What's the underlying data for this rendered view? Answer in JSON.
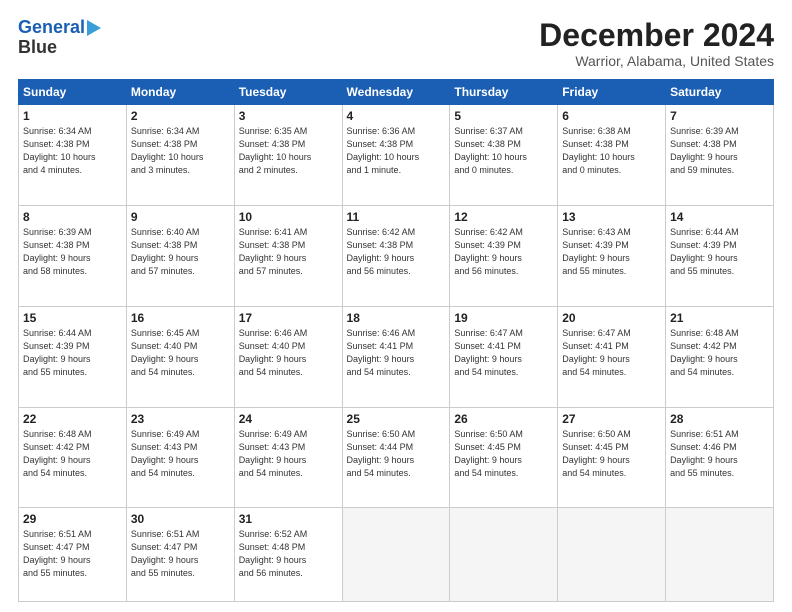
{
  "header": {
    "logo_line1": "General",
    "logo_line2": "Blue",
    "title": "December 2024",
    "subtitle": "Warrior, Alabama, United States"
  },
  "calendar": {
    "headers": [
      "Sunday",
      "Monday",
      "Tuesday",
      "Wednesday",
      "Thursday",
      "Friday",
      "Saturday"
    ],
    "rows": [
      [
        {
          "day": "1",
          "info": "Sunrise: 6:34 AM\nSunset: 4:38 PM\nDaylight: 10 hours\nand 4 minutes."
        },
        {
          "day": "2",
          "info": "Sunrise: 6:34 AM\nSunset: 4:38 PM\nDaylight: 10 hours\nand 3 minutes."
        },
        {
          "day": "3",
          "info": "Sunrise: 6:35 AM\nSunset: 4:38 PM\nDaylight: 10 hours\nand 2 minutes."
        },
        {
          "day": "4",
          "info": "Sunrise: 6:36 AM\nSunset: 4:38 PM\nDaylight: 10 hours\nand 1 minute."
        },
        {
          "day": "5",
          "info": "Sunrise: 6:37 AM\nSunset: 4:38 PM\nDaylight: 10 hours\nand 0 minutes."
        },
        {
          "day": "6",
          "info": "Sunrise: 6:38 AM\nSunset: 4:38 PM\nDaylight: 10 hours\nand 0 minutes."
        },
        {
          "day": "7",
          "info": "Sunrise: 6:39 AM\nSunset: 4:38 PM\nDaylight: 9 hours\nand 59 minutes."
        }
      ],
      [
        {
          "day": "8",
          "info": "Sunrise: 6:39 AM\nSunset: 4:38 PM\nDaylight: 9 hours\nand 58 minutes."
        },
        {
          "day": "9",
          "info": "Sunrise: 6:40 AM\nSunset: 4:38 PM\nDaylight: 9 hours\nand 57 minutes."
        },
        {
          "day": "10",
          "info": "Sunrise: 6:41 AM\nSunset: 4:38 PM\nDaylight: 9 hours\nand 57 minutes."
        },
        {
          "day": "11",
          "info": "Sunrise: 6:42 AM\nSunset: 4:38 PM\nDaylight: 9 hours\nand 56 minutes."
        },
        {
          "day": "12",
          "info": "Sunrise: 6:42 AM\nSunset: 4:39 PM\nDaylight: 9 hours\nand 56 minutes."
        },
        {
          "day": "13",
          "info": "Sunrise: 6:43 AM\nSunset: 4:39 PM\nDaylight: 9 hours\nand 55 minutes."
        },
        {
          "day": "14",
          "info": "Sunrise: 6:44 AM\nSunset: 4:39 PM\nDaylight: 9 hours\nand 55 minutes."
        }
      ],
      [
        {
          "day": "15",
          "info": "Sunrise: 6:44 AM\nSunset: 4:39 PM\nDaylight: 9 hours\nand 55 minutes."
        },
        {
          "day": "16",
          "info": "Sunrise: 6:45 AM\nSunset: 4:40 PM\nDaylight: 9 hours\nand 54 minutes."
        },
        {
          "day": "17",
          "info": "Sunrise: 6:46 AM\nSunset: 4:40 PM\nDaylight: 9 hours\nand 54 minutes."
        },
        {
          "day": "18",
          "info": "Sunrise: 6:46 AM\nSunset: 4:41 PM\nDaylight: 9 hours\nand 54 minutes."
        },
        {
          "day": "19",
          "info": "Sunrise: 6:47 AM\nSunset: 4:41 PM\nDaylight: 9 hours\nand 54 minutes."
        },
        {
          "day": "20",
          "info": "Sunrise: 6:47 AM\nSunset: 4:41 PM\nDaylight: 9 hours\nand 54 minutes."
        },
        {
          "day": "21",
          "info": "Sunrise: 6:48 AM\nSunset: 4:42 PM\nDaylight: 9 hours\nand 54 minutes."
        }
      ],
      [
        {
          "day": "22",
          "info": "Sunrise: 6:48 AM\nSunset: 4:42 PM\nDaylight: 9 hours\nand 54 minutes."
        },
        {
          "day": "23",
          "info": "Sunrise: 6:49 AM\nSunset: 4:43 PM\nDaylight: 9 hours\nand 54 minutes."
        },
        {
          "day": "24",
          "info": "Sunrise: 6:49 AM\nSunset: 4:43 PM\nDaylight: 9 hours\nand 54 minutes."
        },
        {
          "day": "25",
          "info": "Sunrise: 6:50 AM\nSunset: 4:44 PM\nDaylight: 9 hours\nand 54 minutes."
        },
        {
          "day": "26",
          "info": "Sunrise: 6:50 AM\nSunset: 4:45 PM\nDaylight: 9 hours\nand 54 minutes."
        },
        {
          "day": "27",
          "info": "Sunrise: 6:50 AM\nSunset: 4:45 PM\nDaylight: 9 hours\nand 54 minutes."
        },
        {
          "day": "28",
          "info": "Sunrise: 6:51 AM\nSunset: 4:46 PM\nDaylight: 9 hours\nand 55 minutes."
        }
      ],
      [
        {
          "day": "29",
          "info": "Sunrise: 6:51 AM\nSunset: 4:47 PM\nDaylight: 9 hours\nand 55 minutes."
        },
        {
          "day": "30",
          "info": "Sunrise: 6:51 AM\nSunset: 4:47 PM\nDaylight: 9 hours\nand 55 minutes."
        },
        {
          "day": "31",
          "info": "Sunrise: 6:52 AM\nSunset: 4:48 PM\nDaylight: 9 hours\nand 56 minutes."
        },
        {
          "day": "",
          "info": "",
          "empty": true
        },
        {
          "day": "",
          "info": "",
          "empty": true
        },
        {
          "day": "",
          "info": "",
          "empty": true
        },
        {
          "day": "",
          "info": "",
          "empty": true
        }
      ]
    ]
  }
}
